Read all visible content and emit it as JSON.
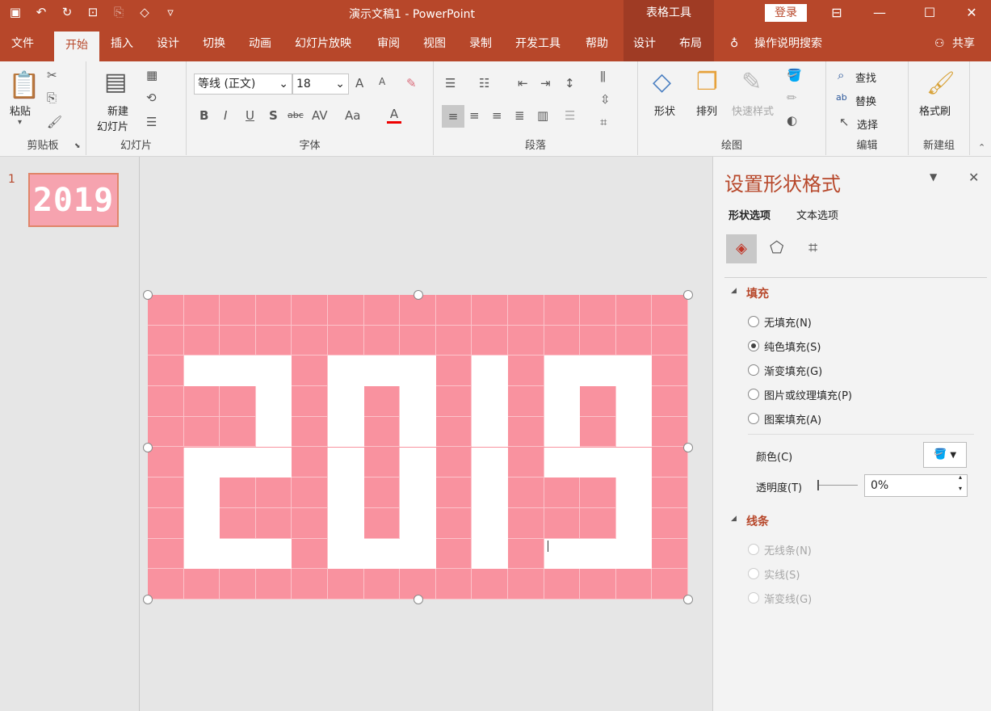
{
  "window": {
    "title": "演示文稿1  -  PowerPoint",
    "context_group": "表格工具",
    "login": "登录"
  },
  "qat_icons": [
    "save-icon",
    "undo-icon",
    "redo-icon",
    "slideshow-icon",
    "copy-format-icon",
    "shapes-icon",
    "customize-icon"
  ],
  "tabs": [
    "文件",
    "开始",
    "插入",
    "设计",
    "切换",
    "动画",
    "幻灯片放映",
    "审阅",
    "视图",
    "录制",
    "开发工具",
    "帮助",
    "设计",
    "布局"
  ],
  "tell_me": "操作说明搜索",
  "share": "共享",
  "ribbon": {
    "clipboard": {
      "paste": "粘贴",
      "group": "剪贴板"
    },
    "slides": {
      "new_slide_line1": "新建",
      "new_slide_line2": "幻灯片",
      "group": "幻灯片"
    },
    "font": {
      "name": "等线 (正文)",
      "size": "18",
      "group": "字体",
      "buttons": [
        "B",
        "I",
        "U",
        "S",
        "abc",
        "AV",
        "Aa",
        "A"
      ]
    },
    "paragraph": {
      "group": "段落"
    },
    "drawing": {
      "shapes": "形状",
      "arrange": "排列",
      "quick_styles": "快速样式",
      "group": "绘图"
    },
    "editing": {
      "find": "查找",
      "replace": "替换",
      "select": "选择",
      "group": "编辑"
    },
    "newgroup": {
      "format_painter": "格式刷",
      "group": "新建组"
    }
  },
  "thumbnail": {
    "number": "1",
    "text": "2019"
  },
  "pane": {
    "title": "设置形状格式",
    "tabs": [
      "形状选项",
      "文本选项"
    ],
    "fill_section": "填充",
    "fill_options": [
      {
        "label": "无填充(N)",
        "selected": false
      },
      {
        "label": "纯色填充(S)",
        "selected": true
      },
      {
        "label": "渐变填充(G)",
        "selected": false
      },
      {
        "label": "图片或纹理填充(P)",
        "selected": false
      },
      {
        "label": "图案填充(A)",
        "selected": false
      }
    ],
    "color_label": "颜色(C)",
    "transparency_label": "透明度(T)",
    "transparency_value": "0%",
    "line_section": "线条",
    "line_options": [
      {
        "label": "无线条(N)"
      },
      {
        "label": "实线(S)"
      },
      {
        "label": "渐变线(G)"
      }
    ]
  },
  "colors": {
    "accent": "#b7472a",
    "cell_pink": "#f9929f",
    "cell_white": "#ffffff"
  },
  "table_grid": {
    "rows": 10,
    "cols": 15,
    "white_cells": [
      [
        2,
        1
      ],
      [
        2,
        2
      ],
      [
        2,
        3
      ],
      [
        2,
        5
      ],
      [
        2,
        6
      ],
      [
        2,
        7
      ],
      [
        2,
        9
      ],
      [
        2,
        11
      ],
      [
        2,
        12
      ],
      [
        2,
        13
      ],
      [
        3,
        3
      ],
      [
        3,
        5
      ],
      [
        3,
        7
      ],
      [
        3,
        9
      ],
      [
        3,
        11
      ],
      [
        3,
        13
      ],
      [
        4,
        3
      ],
      [
        4,
        5
      ],
      [
        4,
        7
      ],
      [
        4,
        9
      ],
      [
        4,
        11
      ],
      [
        4,
        13
      ],
      [
        5,
        1
      ],
      [
        5,
        2
      ],
      [
        5,
        3
      ],
      [
        5,
        5
      ],
      [
        5,
        7
      ],
      [
        5,
        9
      ],
      [
        5,
        11
      ],
      [
        5,
        12
      ],
      [
        5,
        13
      ],
      [
        6,
        1
      ],
      [
        6,
        5
      ],
      [
        6,
        7
      ],
      [
        6,
        9
      ],
      [
        6,
        13
      ],
      [
        7,
        1
      ],
      [
        7,
        5
      ],
      [
        7,
        7
      ],
      [
        7,
        9
      ],
      [
        7,
        13
      ],
      [
        8,
        1
      ],
      [
        8,
        2
      ],
      [
        8,
        3
      ],
      [
        8,
        5
      ],
      [
        8,
        6
      ],
      [
        8,
        7
      ],
      [
        8,
        9
      ],
      [
        8,
        11
      ],
      [
        8,
        12
      ],
      [
        8,
        13
      ]
    ]
  }
}
